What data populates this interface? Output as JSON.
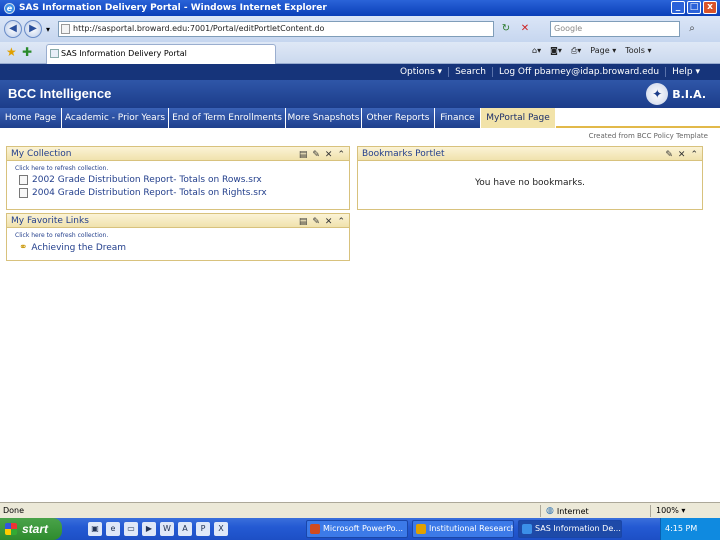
{
  "window": {
    "title": "SAS Information Delivery Portal - Windows Internet Explorer",
    "buttons": [
      "_",
      "□",
      "x"
    ]
  },
  "browser": {
    "url": "http://sasportal.broward.edu:7001/Portal/editPortletContent.do",
    "search_placeholder": "Google",
    "tab_title": "SAS Information Delivery Portal",
    "command_bar": [
      "Page ▾",
      "Tools ▾"
    ]
  },
  "portal": {
    "top_nav": [
      "Options ▾",
      "Search",
      "Log Off pbarney@idap.broward.edu",
      "Help ▾"
    ],
    "title": "BCC Intelligence",
    "logo_text": "B.I.A.",
    "tabs": [
      {
        "label": "Home Page",
        "active": false
      },
      {
        "label": "Academic - Prior Years",
        "active": false
      },
      {
        "label": "End of Term Enrollments",
        "active": false
      },
      {
        "label": "More Snapshots",
        "active": false
      },
      {
        "label": "Other Reports",
        "active": false
      },
      {
        "label": "Finance",
        "active": false
      },
      {
        "label": "MyPortal Page",
        "active": true
      }
    ],
    "breadcrumb": "Created from BCC Policy Template"
  },
  "portlets": {
    "collection": {
      "title": "My Collection",
      "refresh": "Click here to refresh collection.",
      "items": [
        "2002 Grade Distribution Report- Totals on Rows.srx",
        "2004 Grade Distribution Report- Totals on Rights.srx"
      ]
    },
    "favorites": {
      "title": "My Favorite Links",
      "refresh": "Click here to refresh collection.",
      "items": [
        "Achieving the Dream"
      ]
    },
    "bookmarks": {
      "title": "Bookmarks Portlet",
      "empty_message": "You have no bookmarks."
    }
  },
  "status": {
    "left": "Done",
    "zone": "Internet",
    "zoom": "100% ▾"
  },
  "taskbar": {
    "start": "start",
    "items": [
      {
        "label": "Microsoft PowerPo...",
        "active": false,
        "color": "#d14b1f"
      },
      {
        "label": "Institutional Research ...",
        "active": false,
        "color": "#e0a000"
      },
      {
        "label": "SAS Information De...",
        "active": true,
        "color": "#3b8fe8"
      }
    ],
    "clock": "4:15 PM"
  }
}
